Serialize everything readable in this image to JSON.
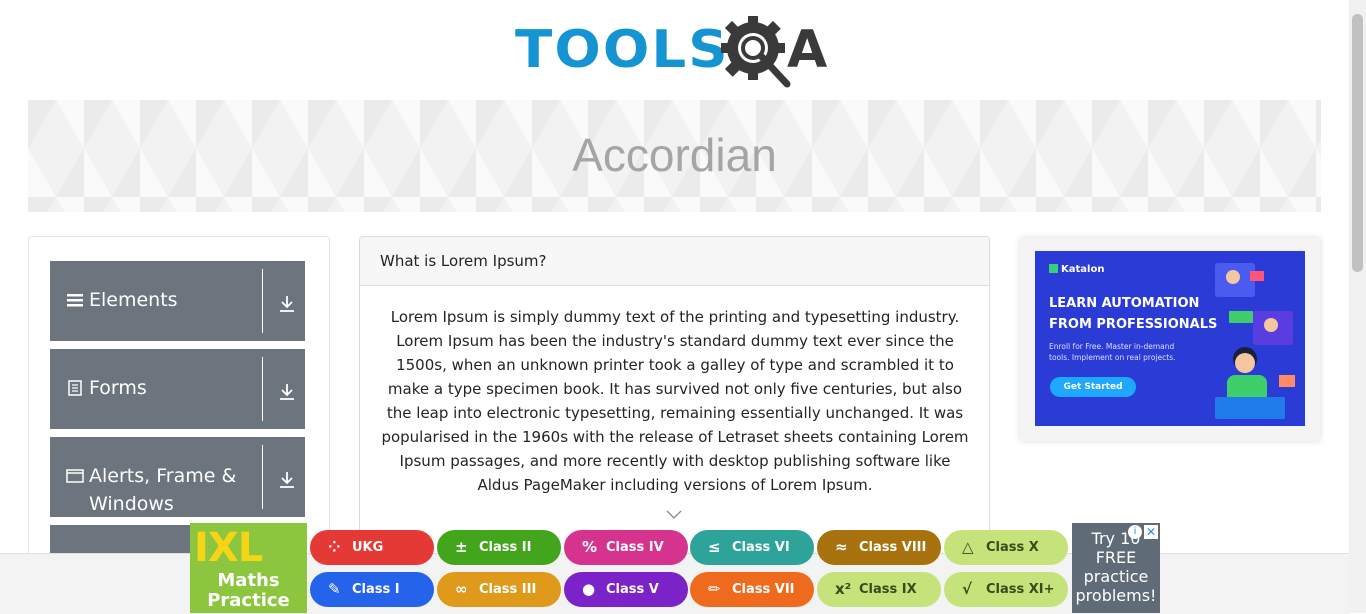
{
  "logo": {
    "part1": "TOOLS",
    "part2": "A"
  },
  "page": {
    "title": "Accordian"
  },
  "sidebar": {
    "groups": [
      {
        "label": "Elements",
        "icon": "hamburger-icon"
      },
      {
        "label": "Forms",
        "icon": "document-icon"
      },
      {
        "label": "Alerts, Frame & Windows",
        "icon": "window-icon"
      }
    ]
  },
  "accordion": {
    "section1": {
      "header": "What is Lorem Ipsum?",
      "body": "Lorem Ipsum is simply dummy text of the printing and typesetting industry. Lorem Ipsum has been the industry's standard dummy text ever since the 1500s, when an unknown printer took a galley of type and scrambled it to make a type specimen book. It has survived not only five centuries, but also the leap into electronic typesetting, remaining essentially unchanged. It was popularised in the 1960s with the release of Letraset sheets containing Lorem Ipsum passages, and more recently with desktop publishing software like Aldus PageMaker including versions of Lorem Ipsum."
    }
  },
  "side_ad": {
    "brand": "Katalon",
    "headline": "LEARN AUTOMATION FROM PROFESSIONALS",
    "sub": "Enroll for Free. Master in-demand tools. Implement on real projects.",
    "cta": "Get Started"
  },
  "bottom_ad": {
    "logo": "IXL",
    "logo_sub": "Maths Practice",
    "pills": [
      {
        "label": "UKG",
        "icon": "dots-icon",
        "color": "#e53935"
      },
      {
        "label": "Class II",
        "icon": "plus-minus-icon",
        "color": "#43a51c"
      },
      {
        "label": "Class IV",
        "icon": "percent-icon",
        "color": "#d6338f"
      },
      {
        "label": "Class VI",
        "icon": "less-equal-icon",
        "color": "#2ea39a"
      },
      {
        "label": "Class VIII",
        "icon": "approx-icon",
        "color": "#a8720f"
      },
      {
        "label": "Class X",
        "icon": "triangle-icon",
        "color": "#c6e27a"
      },
      {
        "label": "Class I",
        "icon": "pencil-cup-icon",
        "color": "#2563eb"
      },
      {
        "label": "Class III",
        "icon": "infinity-icon",
        "color": "#e09a1b"
      },
      {
        "label": "Class V",
        "icon": "apple-icon",
        "color": "#7b22c8"
      },
      {
        "label": "Class VII",
        "icon": "pencil-icon",
        "color": "#f06a1d"
      },
      {
        "label": "Class IX",
        "icon": "x-squared-icon",
        "color": "#c6e27a"
      },
      {
        "label": "Class XI+",
        "icon": "root-icon",
        "color": "#c6e27a"
      }
    ],
    "try_text": "Try 10 FREE practice problems!"
  }
}
